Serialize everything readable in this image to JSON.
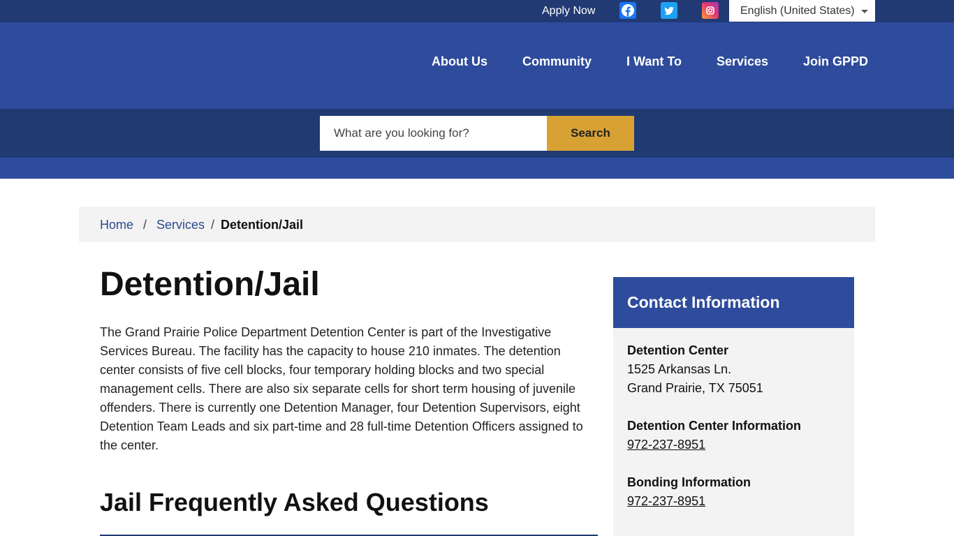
{
  "utility_bar": {
    "apply_now": "Apply Now",
    "social_icons": [
      "facebook-icon",
      "twitter-icon",
      "instagram-icon"
    ],
    "language": "English (United States)"
  },
  "nav": {
    "items": [
      "About Us",
      "Community",
      "I Want To",
      "Services",
      "Join GPPD"
    ]
  },
  "search": {
    "placeholder": "What are you looking for?",
    "button_label": "Search"
  },
  "breadcrumb": {
    "items": [
      "Home",
      "Services"
    ],
    "separator": "/",
    "current": "Detention/Jail"
  },
  "main": {
    "title": "Detention/Jail",
    "intro": "The Grand Prairie Police Department Detention Center is part of the Investigative Services Bureau. The facility has the capacity to house 210 inmates. The detention center consists of five cell blocks, four temporary holding blocks and two special management cells. There are also six separate cells for short term housing of juvenile offenders. There is currently one Detention Manager, four Detention Supervisors, eight Detention Team Leads and six part-time and 28 full-time Detention Officers assigned to the center.",
    "faq_heading": "Jail Frequently Asked Questions"
  },
  "sidebar": {
    "title": "Contact Information",
    "location": {
      "label": "Detention Center",
      "address_line1": "1525 Arkansas Ln.",
      "address_line2": "Grand Prairie, TX 75051"
    },
    "info": {
      "label": "Detention Center Information",
      "phone": "972-237-8951"
    },
    "bonding": {
      "label": "Bonding Information",
      "phone": "972-237-8951"
    }
  },
  "colors": {
    "utility_bar": "#223a74",
    "header": "#2e4b9c",
    "search_band": "#203a72",
    "search_button": "#d7a233",
    "breadcrumb_bg": "#f3f3f3",
    "link": "#2a4a8e"
  }
}
